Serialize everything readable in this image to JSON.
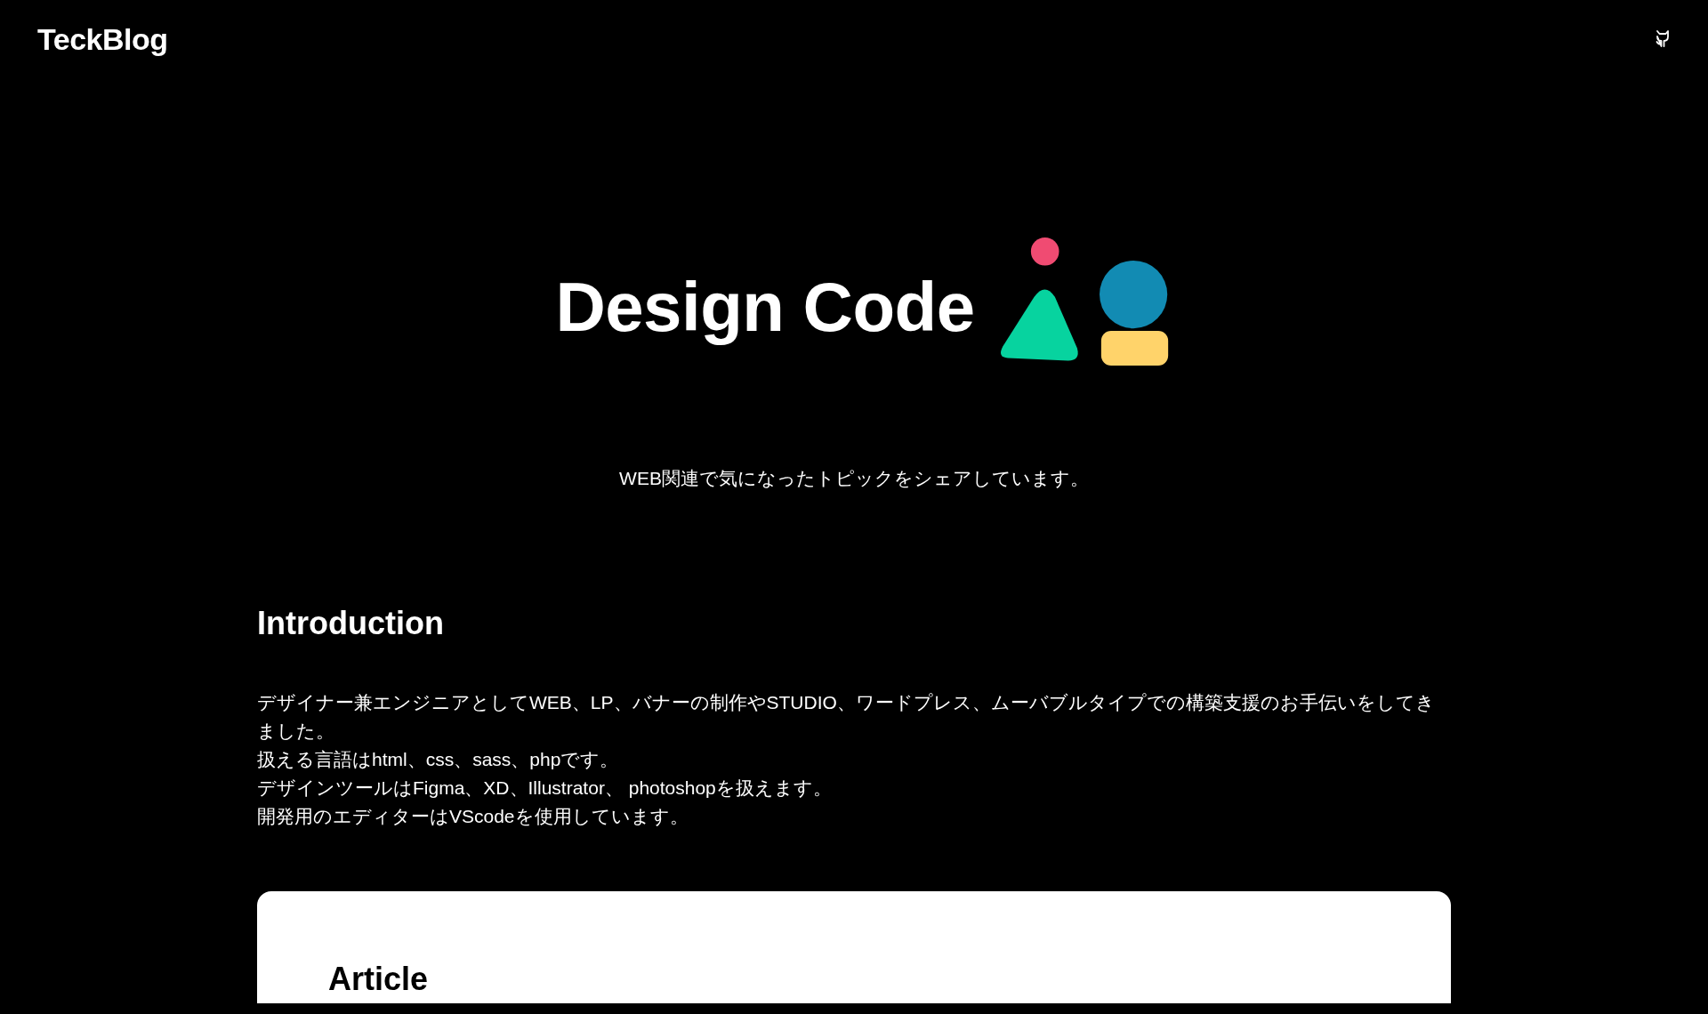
{
  "header": {
    "logo": "TeckBlog"
  },
  "hero": {
    "title": "Design Code",
    "tagline": "WEB関連で気になったトピックをシェアしています。"
  },
  "introduction": {
    "heading": "Introduction",
    "lines": [
      "デザイナー兼エンジニアとしてWEB、LP、バナーの制作やSTUDIO、ワードプレス、ムーバブルタイプでの構築支援のお手伝いをしてきました。",
      "扱える言語はhtml、css、sass、phpです。",
      "デザインツールはFigma、XD、Illustrator、 photoshopを扱えます。",
      "開発用のエディターはVScodeを使用しています。"
    ]
  },
  "article": {
    "heading": "Article"
  }
}
